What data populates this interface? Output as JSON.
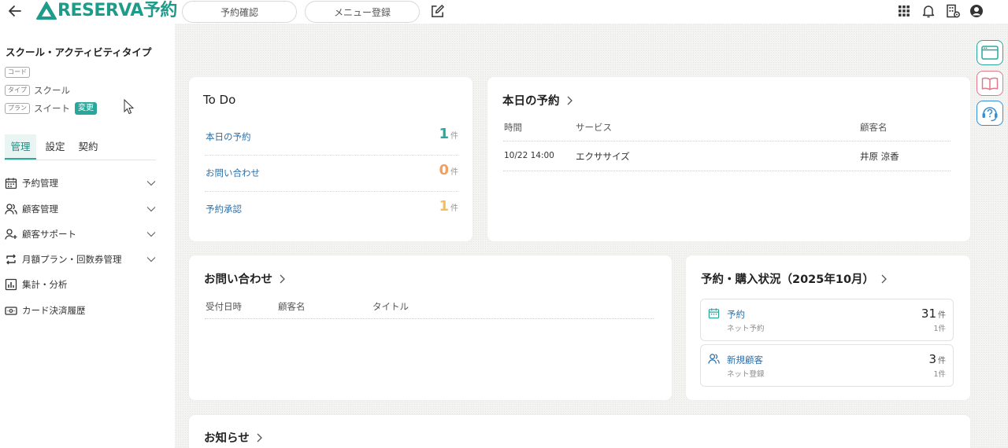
{
  "header": {
    "logo_text": "RESERVA予約",
    "nav_reservation_check": "予約確認",
    "nav_menu_register": "メニュー登録"
  },
  "sidebar": {
    "shop_title": "スクール・アクティビティタイプ",
    "code_tag": "コード",
    "code_value": "",
    "type_tag": "タイプ",
    "type_value": "スクール",
    "plan_tag": "プラン",
    "plan_value": "スイート",
    "change_label": "変更",
    "tabs": [
      "管理",
      "設定",
      "契約"
    ],
    "nav_items": [
      {
        "label": "予約管理",
        "icon": "calendar-icon",
        "expandable": true
      },
      {
        "label": "顧客管理",
        "icon": "users-icon",
        "expandable": true
      },
      {
        "label": "顧客サポート",
        "icon": "user-support-icon",
        "expandable": true
      },
      {
        "label": "月額プラン・回数券管理",
        "icon": "repeat-icon",
        "expandable": true
      },
      {
        "label": "集計・分析",
        "icon": "chart-icon",
        "expandable": false
      },
      {
        "label": "カード決済履歴",
        "icon": "card-icon",
        "expandable": false
      }
    ]
  },
  "todo": {
    "title": "To Do",
    "rows": [
      {
        "label": "本日の予約",
        "count": "1",
        "unit": "件",
        "color": "#2aa79b"
      },
      {
        "label": "お問い合わせ",
        "count": "0",
        "unit": "件",
        "color": "#f0a060"
      },
      {
        "label": "予約承認",
        "count": "1",
        "unit": "件",
        "color": "#f0c060"
      }
    ]
  },
  "today": {
    "title": "本日の予約",
    "columns": [
      "時間",
      "サービス",
      "顧客名"
    ],
    "rows": [
      {
        "time": "10/22 14:00",
        "service": "エクササイズ",
        "customer": "井原 涼香"
      }
    ]
  },
  "inquiries": {
    "title": "お問い合わせ",
    "columns": [
      "受付日時",
      "顧客名",
      "タイトル"
    ]
  },
  "status": {
    "title": "予約・購入状況（2025年10月）",
    "items": [
      {
        "label": "予約",
        "sub": "ネット予約",
        "count": "31",
        "unit": "件",
        "subcount": "1件",
        "icon": "calendar-icon"
      },
      {
        "label": "新規顧客",
        "sub": "ネット登録",
        "count": "3",
        "unit": "件",
        "subcount": "1件",
        "icon": "users-icon"
      }
    ]
  },
  "notices": {
    "title": "お知らせ"
  },
  "colors": {
    "brand": "#1f9b8a",
    "accent": "#2aa79b",
    "link": "#2b6fa8"
  }
}
